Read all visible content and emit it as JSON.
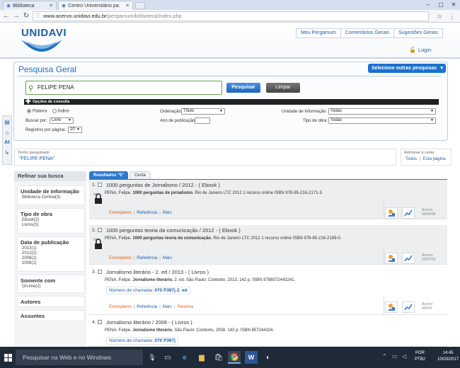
{
  "browser": {
    "tabs": [
      {
        "label": "Biblioteca"
      },
      {
        "label": "Centro Universitário pa:"
      }
    ],
    "url_domain": "www.acervo.unidavi.edu.br",
    "url_path": "/pergamum/biblioteca/index.php"
  },
  "header": {
    "logo": "UNIDAVI",
    "nav": [
      "Meu Pergamum",
      "Comentários Gerais",
      "Sugestões Gerais"
    ],
    "login": "Login"
  },
  "search": {
    "title": "Pesquisa Geral",
    "other_searches": "Selecione outras pesquisas",
    "query": "FELIPE PENA",
    "search_button": "Pesquisar",
    "clear_button": "Limpar",
    "options_title": "Opções de consulta",
    "radio_palavra": "Palavra",
    "radio_indice": "Índice",
    "buscar_por_label": "Buscar por:",
    "buscar_por_value": "Livre",
    "registros_label": "Registros por página:",
    "registros_value": "20",
    "ordenacao_label": "Ordenação:",
    "ordenacao_value": "Título",
    "ano_label": "Ano de publicação:",
    "ano_value": "",
    "unidade_label": "Unidade de Informação:",
    "unidade_value": "Todas",
    "tipo_label": "Tipo de obra:",
    "tipo_value": "Todas"
  },
  "termo": {
    "label": "Termo pesquisado",
    "value": "\"FELIPE PENA\""
  },
  "cesta": {
    "label": "Adicionar à cesta:",
    "todos": "Todos",
    "sep": "|",
    "esta_pagina": "Esta página"
  },
  "refine": {
    "title": "Refinar sua busca",
    "groups": [
      {
        "title": "Unidade de Informação",
        "values": [
          "Biblioteca Central(3)"
        ]
      },
      {
        "title": "Tipo de obra",
        "values": [
          "Ebook(2)",
          "Livros(3)"
        ]
      },
      {
        "title": "Data de publicação",
        "values": [
          "2013(1)",
          "2012(2)",
          "2008(1)",
          "2006(1)"
        ]
      },
      {
        "title": "Somente com",
        "values": [
          "On-line(2)"
        ]
      },
      {
        "title": "Autores",
        "values": []
      },
      {
        "title": "Assuntos",
        "values": []
      }
    ]
  },
  "results_tabs": {
    "results": "Resultados \"5\"",
    "cesta": "Cesta"
  },
  "results": [
    {
      "num": "1.",
      "title": "1000 perguntas de Jornalismo / 2012 -  ( Ebook )",
      "author": "PENA, Felipe.",
      "bold": "1000 perguntas de jornalismo.",
      "rest": "Rio de Janeiro LTC 2012 1 recurso online ISBN 978-85-216-2171-3.",
      "links": [
        "Exemplares",
        "Referência",
        "Marc"
      ],
      "acervo_label": "Acervo",
      "acervo": "5000698"
    },
    {
      "num": "2.",
      "title": "1000 perguntas teoria da comunicação / 2012 -  ( Ebook )",
      "author": "PENA, Felipe.",
      "bold": "1000 perguntas teoria da comunicação.",
      "rest": "Rio de Janeiro LTC 2012 1 recurso online ISBN 978-85-216-2169-0.",
      "links": [
        "Exemplares",
        "Referência",
        "Marc"
      ],
      "acervo_label": "Acervo",
      "acervo": "5000700"
    },
    {
      "num": "3.",
      "title": "Jornalismo literário - 2. ed / 2013 -  ( Livros )",
      "author": "PENA, Felipe.",
      "bold": "Jornalismo literário.",
      "rest": "2. ed. São Paulo: Contexto, 2013. 142 p. ISBN 9788572443241.",
      "callno_label": "Número de chamada:",
      "callno": "070 P397j 2. ed",
      "links": [
        "Exemplares",
        "Referência",
        "Marc",
        "Reserva"
      ],
      "acervo_label": "Acervo",
      "acervo": "43478"
    },
    {
      "num": "4.",
      "title": "Jornalismo literário / 2008 -  ( Livros )",
      "author": "PENA, Felipe.",
      "bold": "Jornalismo literário.",
      "rest": "São Paulo: Contexto, 2008. 142 p. ISBN 857244324.",
      "callno_label": "Número de chamada:",
      "callno": "070 P397j"
    }
  ],
  "taskbar": {
    "search_placeholder": "Pesquisar na Web e no Windows",
    "lang1": "POR",
    "lang2": "PTB2",
    "time": "14:45",
    "date": "10/03/2017"
  }
}
